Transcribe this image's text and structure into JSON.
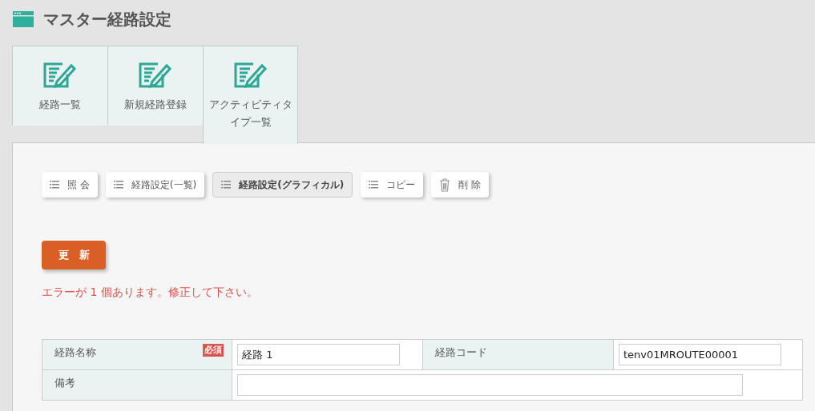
{
  "page_title": "マスター経路設定",
  "tabs": [
    {
      "label": "経路一覧",
      "selected": false
    },
    {
      "label": "新規経路登録",
      "selected": false
    },
    {
      "label": "アクティビティタイプ一覧",
      "selected": true
    }
  ],
  "actions": [
    {
      "label": "照 会",
      "kind": "list",
      "selected": false
    },
    {
      "label": "経路設定(一覧)",
      "kind": "list",
      "selected": false
    },
    {
      "label": "経路設定(グラフィカル)",
      "kind": "list",
      "selected": true
    },
    {
      "label": "コピー",
      "kind": "list",
      "selected": false
    },
    {
      "label": "削 除",
      "kind": "trash",
      "selected": false
    }
  ],
  "update_button": "更　新",
  "error_message": "エラーが 1 個あります。修正して下さい。",
  "form": {
    "name_label": "経路名称",
    "required_badge": "必須",
    "name_value": "経路 1",
    "code_label": "経路コード",
    "code_value": "tenv01MROUTE00001",
    "note_label": "備考"
  }
}
